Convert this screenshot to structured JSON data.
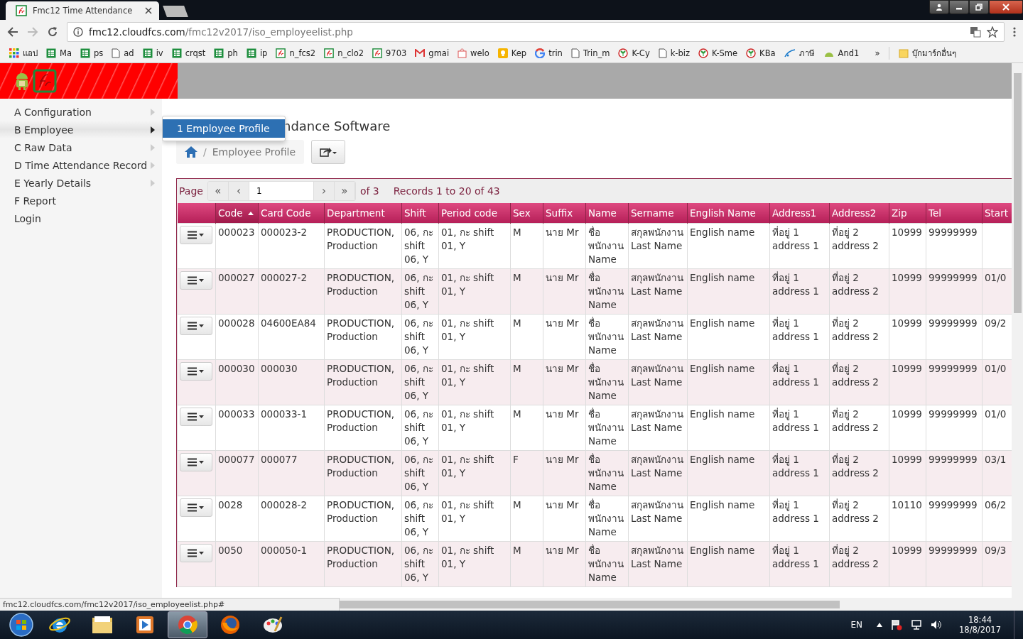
{
  "browser": {
    "tab_title": "Fmc12 Time Attendance",
    "address": {
      "host": "fmc12.cloudfcs.com",
      "path": "/fmc12v2017/iso_employeelist.php"
    },
    "bookmarks": [
      {
        "label": "แอป",
        "kind": "apps"
      },
      {
        "label": "Ma",
        "kind": "sheet"
      },
      {
        "label": "ps",
        "kind": "sheet"
      },
      {
        "label": "ad",
        "kind": "page"
      },
      {
        "label": "iv",
        "kind": "sheet"
      },
      {
        "label": "crqst",
        "kind": "sheet"
      },
      {
        "label": "ph",
        "kind": "sheet"
      },
      {
        "label": "ip",
        "kind": "sheet"
      },
      {
        "label": "n_fcs2",
        "kind": "fc"
      },
      {
        "label": "n_clo2",
        "kind": "fc"
      },
      {
        "label": "9703",
        "kind": "fc"
      },
      {
        "label": "gmai",
        "kind": "mail"
      },
      {
        "label": "welo",
        "kind": "bag"
      },
      {
        "label": "Kep",
        "kind": "bulb"
      },
      {
        "label": "trin",
        "kind": "google"
      },
      {
        "label": "Trin_m",
        "kind": "page"
      },
      {
        "label": "K-Cy",
        "kind": "leaf"
      },
      {
        "label": "k-biz",
        "kind": "page"
      },
      {
        "label": "K-Sme",
        "kind": "leaf"
      },
      {
        "label": "KBa",
        "kind": "leaf"
      },
      {
        "label": "ภาษี",
        "kind": "mof"
      },
      {
        "label": "And1",
        "kind": "android"
      }
    ],
    "more": "»",
    "other_bookmarks": "บุ๊กมาร์กอื่นๆ"
  },
  "sidebar": {
    "items": [
      {
        "label": "A Configuration",
        "submenu": true,
        "selected": false
      },
      {
        "label": "B Employee",
        "submenu": true,
        "selected": true
      },
      {
        "label": "C Raw Data",
        "submenu": true,
        "selected": false
      },
      {
        "label": "D Time Attendance Record",
        "submenu": true,
        "selected": false
      },
      {
        "label": "E Yearly Details",
        "submenu": true,
        "selected": false
      },
      {
        "label": "F Report",
        "submenu": false,
        "selected": false
      },
      {
        "label": "Login",
        "submenu": false,
        "selected": false
      }
    ]
  },
  "submenu": {
    "items": [
      {
        "label": "1 Employee Profile",
        "selected": true
      }
    ]
  },
  "page_title": "ndance Software",
  "breadcrumb": {
    "separator": "/",
    "current": "Employee Profile"
  },
  "pager": {
    "label": "Page",
    "first": "«",
    "prev": "‹",
    "value": "1",
    "next": "›",
    "last": "»",
    "of": "of 3",
    "records": "Records 1 to 20 of 43"
  },
  "table": {
    "columns": [
      {
        "label": "Code",
        "sorted": true
      },
      {
        "label": "Card Code",
        "sorted": false
      },
      {
        "label": "Department",
        "sorted": false
      },
      {
        "label": "Shift",
        "sorted": false
      },
      {
        "label": "Period code",
        "sorted": false
      },
      {
        "label": "Sex",
        "sorted": false
      },
      {
        "label": "Suffix",
        "sorted": false
      },
      {
        "label": "Name",
        "sorted": false
      },
      {
        "label": "Sername",
        "sorted": false
      },
      {
        "label": "English Name",
        "sorted": false
      },
      {
        "label": "Address1",
        "sorted": false
      },
      {
        "label": "Address2",
        "sorted": false
      },
      {
        "label": "Zip",
        "sorted": false
      },
      {
        "label": "Tel",
        "sorted": false
      },
      {
        "label": "Start",
        "sorted": false
      }
    ],
    "rows": [
      [
        "000023",
        "000023-2",
        "PRODUCTION, Production",
        "06, กะ shift 06, Y",
        "01, กะ shift 01, Y",
        "M",
        "นาย Mr",
        "ชื่อ พนักงาน Name",
        "สกุลพนักงาน Last Name",
        "English name",
        "ที่อยู่ 1 address 1",
        "ที่อยู่ 2 address 2",
        "10999",
        "99999999",
        ""
      ],
      [
        "000027",
        "000027-2",
        "PRODUCTION, Production",
        "06, กะ shift 06, Y",
        "01, กะ shift 01, Y",
        "M",
        "นาย Mr",
        "ชื่อ พนักงาน Name",
        "สกุลพนักงาน Last Name",
        "English name",
        "ที่อยู่ 1 address 1",
        "ที่อยู่ 2 address 2",
        "10999",
        "99999999",
        "01/0"
      ],
      [
        "000028",
        "04600EA84",
        "PRODUCTION, Production",
        "06, กะ shift 06, Y",
        "01, กะ shift 01, Y",
        "M",
        "นาย Mr",
        "ชื่อ พนักงาน Name",
        "สกุลพนักงาน Last Name",
        "English name",
        "ที่อยู่ 1 address 1",
        "ที่อยู่ 2 address 2",
        "10999",
        "99999999",
        "09/2"
      ],
      [
        "000030",
        "000030",
        "PRODUCTION, Production",
        "06, กะ shift 06, Y",
        "01, กะ shift 01, Y",
        "M",
        "นาย Mr",
        "ชื่อ พนักงาน Name",
        "สกุลพนักงาน Last Name",
        "English name",
        "ที่อยู่ 1 address 1",
        "ที่อยู่ 2 address 2",
        "10999",
        "99999999",
        "01/0"
      ],
      [
        "000033",
        "000033-1",
        "PRODUCTION, Production",
        "06, กะ shift 06, Y",
        "01, กะ shift 01, Y",
        "M",
        "นาย Mr",
        "ชื่อ พนักงาน Name",
        "สกุลพนักงาน Last Name",
        "English name",
        "ที่อยู่ 1 address 1",
        "ที่อยู่ 2 address 2",
        "10999",
        "99999999",
        "01/0"
      ],
      [
        "000077",
        "000077",
        "PRODUCTION, Production",
        "06, กะ shift 06, Y",
        "01, กะ shift 01, Y",
        "F",
        "นาย Mr",
        "ชื่อ พนักงาน Name",
        "สกุลพนักงาน Last Name",
        "English name",
        "ที่อยู่ 1 address 1",
        "ที่อยู่ 2 address 2",
        "10999",
        "99999999",
        "03/1"
      ],
      [
        "0028",
        "000028-2",
        "PRODUCTION, Production",
        "06, กะ shift 06, Y",
        "01, กะ shift 01, Y",
        "M",
        "นาย Mr",
        "ชื่อ พนักงาน Name",
        "สกุลพนักงาน Last Name",
        "English name",
        "ที่อยู่ 1 address 1",
        "ที่อยู่ 2 address 2",
        "10110",
        "99999999",
        "06/2"
      ],
      [
        "0050",
        "000050-1",
        "PRODUCTION, Production",
        "06, กะ shift 06, Y",
        "01, กะ shift 01, Y",
        "M",
        "นาย Mr",
        "ชื่อ พนักงาน Name",
        "สกุลพนักงาน Last Name",
        "English name",
        "ที่อยู่ 1 address 1",
        "ที่อยู่ 2 address 2",
        "10999",
        "99999999",
        "09/3"
      ]
    ]
  },
  "status_url": "fmc12.cloudfcs.com/fmc12v2017/iso_employeelist.php#",
  "taskbar": {
    "apps": [
      {
        "kind": "ie",
        "selected": false
      },
      {
        "kind": "folder",
        "selected": false
      },
      {
        "kind": "media",
        "selected": false
      },
      {
        "kind": "chrome",
        "selected": true
      },
      {
        "kind": "firefox",
        "selected": false
      },
      {
        "kind": "paint",
        "selected": false
      }
    ],
    "language": "EN",
    "time": "18:44",
    "date": "18/8/2017"
  }
}
